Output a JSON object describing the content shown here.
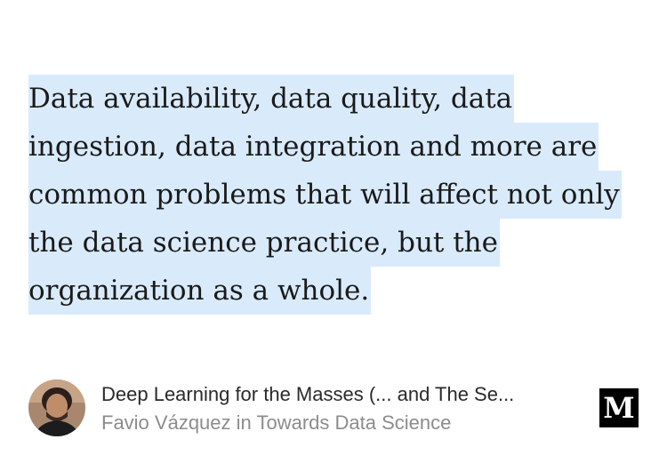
{
  "quote": {
    "lines": [
      "Data availability, data quality, data",
      "ingestion, data integration and more are",
      "common problems that will affect not only",
      "the data science practice, but the",
      "organization as a whole."
    ],
    "highlight_color": "#d9ebfb"
  },
  "footer": {
    "avatar_icon": "author-avatar",
    "article_title": "Deep Learning for the Masses (... and The Se...",
    "byline": "Favio Vázquez in Towards Data Science",
    "logo_letter": "M"
  }
}
